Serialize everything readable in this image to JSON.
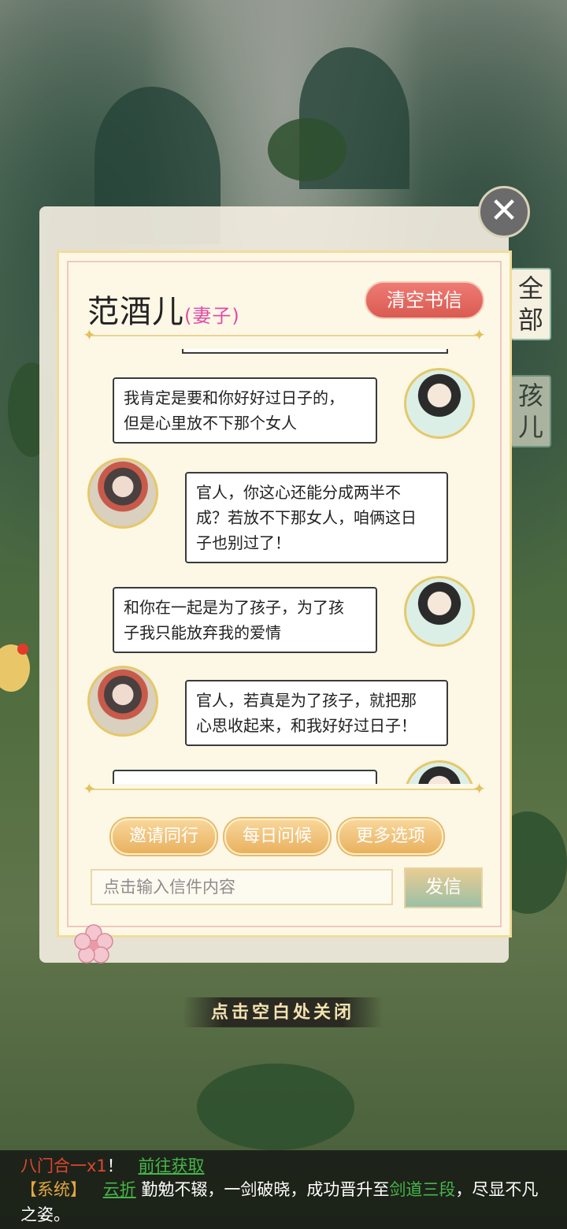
{
  "letter": {
    "name": "范酒儿",
    "relation": "(妻子)",
    "clear_label": "清空书信"
  },
  "side_tabs": [
    "全部",
    "孩儿"
  ],
  "messages": [
    {
      "sender": "self",
      "text_lines": [
        "我肯定是要和你好好过日子的，",
        "但是心里放不下那个女人"
      ]
    },
    {
      "sender": "wife",
      "text_lines": [
        "官人，你这心还能分成两半不",
        "成？若放不下那女人，咱俩这日",
        "子也别过了！"
      ]
    },
    {
      "sender": "self",
      "text_lines": [
        "和你在一起是为了孩子，为了孩",
        "子我只能放弃我的爱情"
      ]
    },
    {
      "sender": "wife",
      "text_lines": [
        "官人，若真是为了孩子，就把那",
        "心思收起来，和我好好过日子！"
      ]
    }
  ],
  "options": {
    "invite": "邀请同行",
    "daily": "每日问候",
    "more": "更多选项"
  },
  "input": {
    "placeholder": "点击输入信件内容",
    "send_label": "发信"
  },
  "hint": "点击空白处关闭",
  "system": {
    "line1_item": "八门合一x1",
    "line1_sep": "！",
    "line1_link": "前往获取",
    "tag": "【系统】",
    "player": "云折",
    "text_a": "勤勉不辍，一剑破晓，成功晋升至",
    "rank": "剑道三段",
    "text_b": "，尽显不凡",
    "text_c": "之姿。"
  }
}
